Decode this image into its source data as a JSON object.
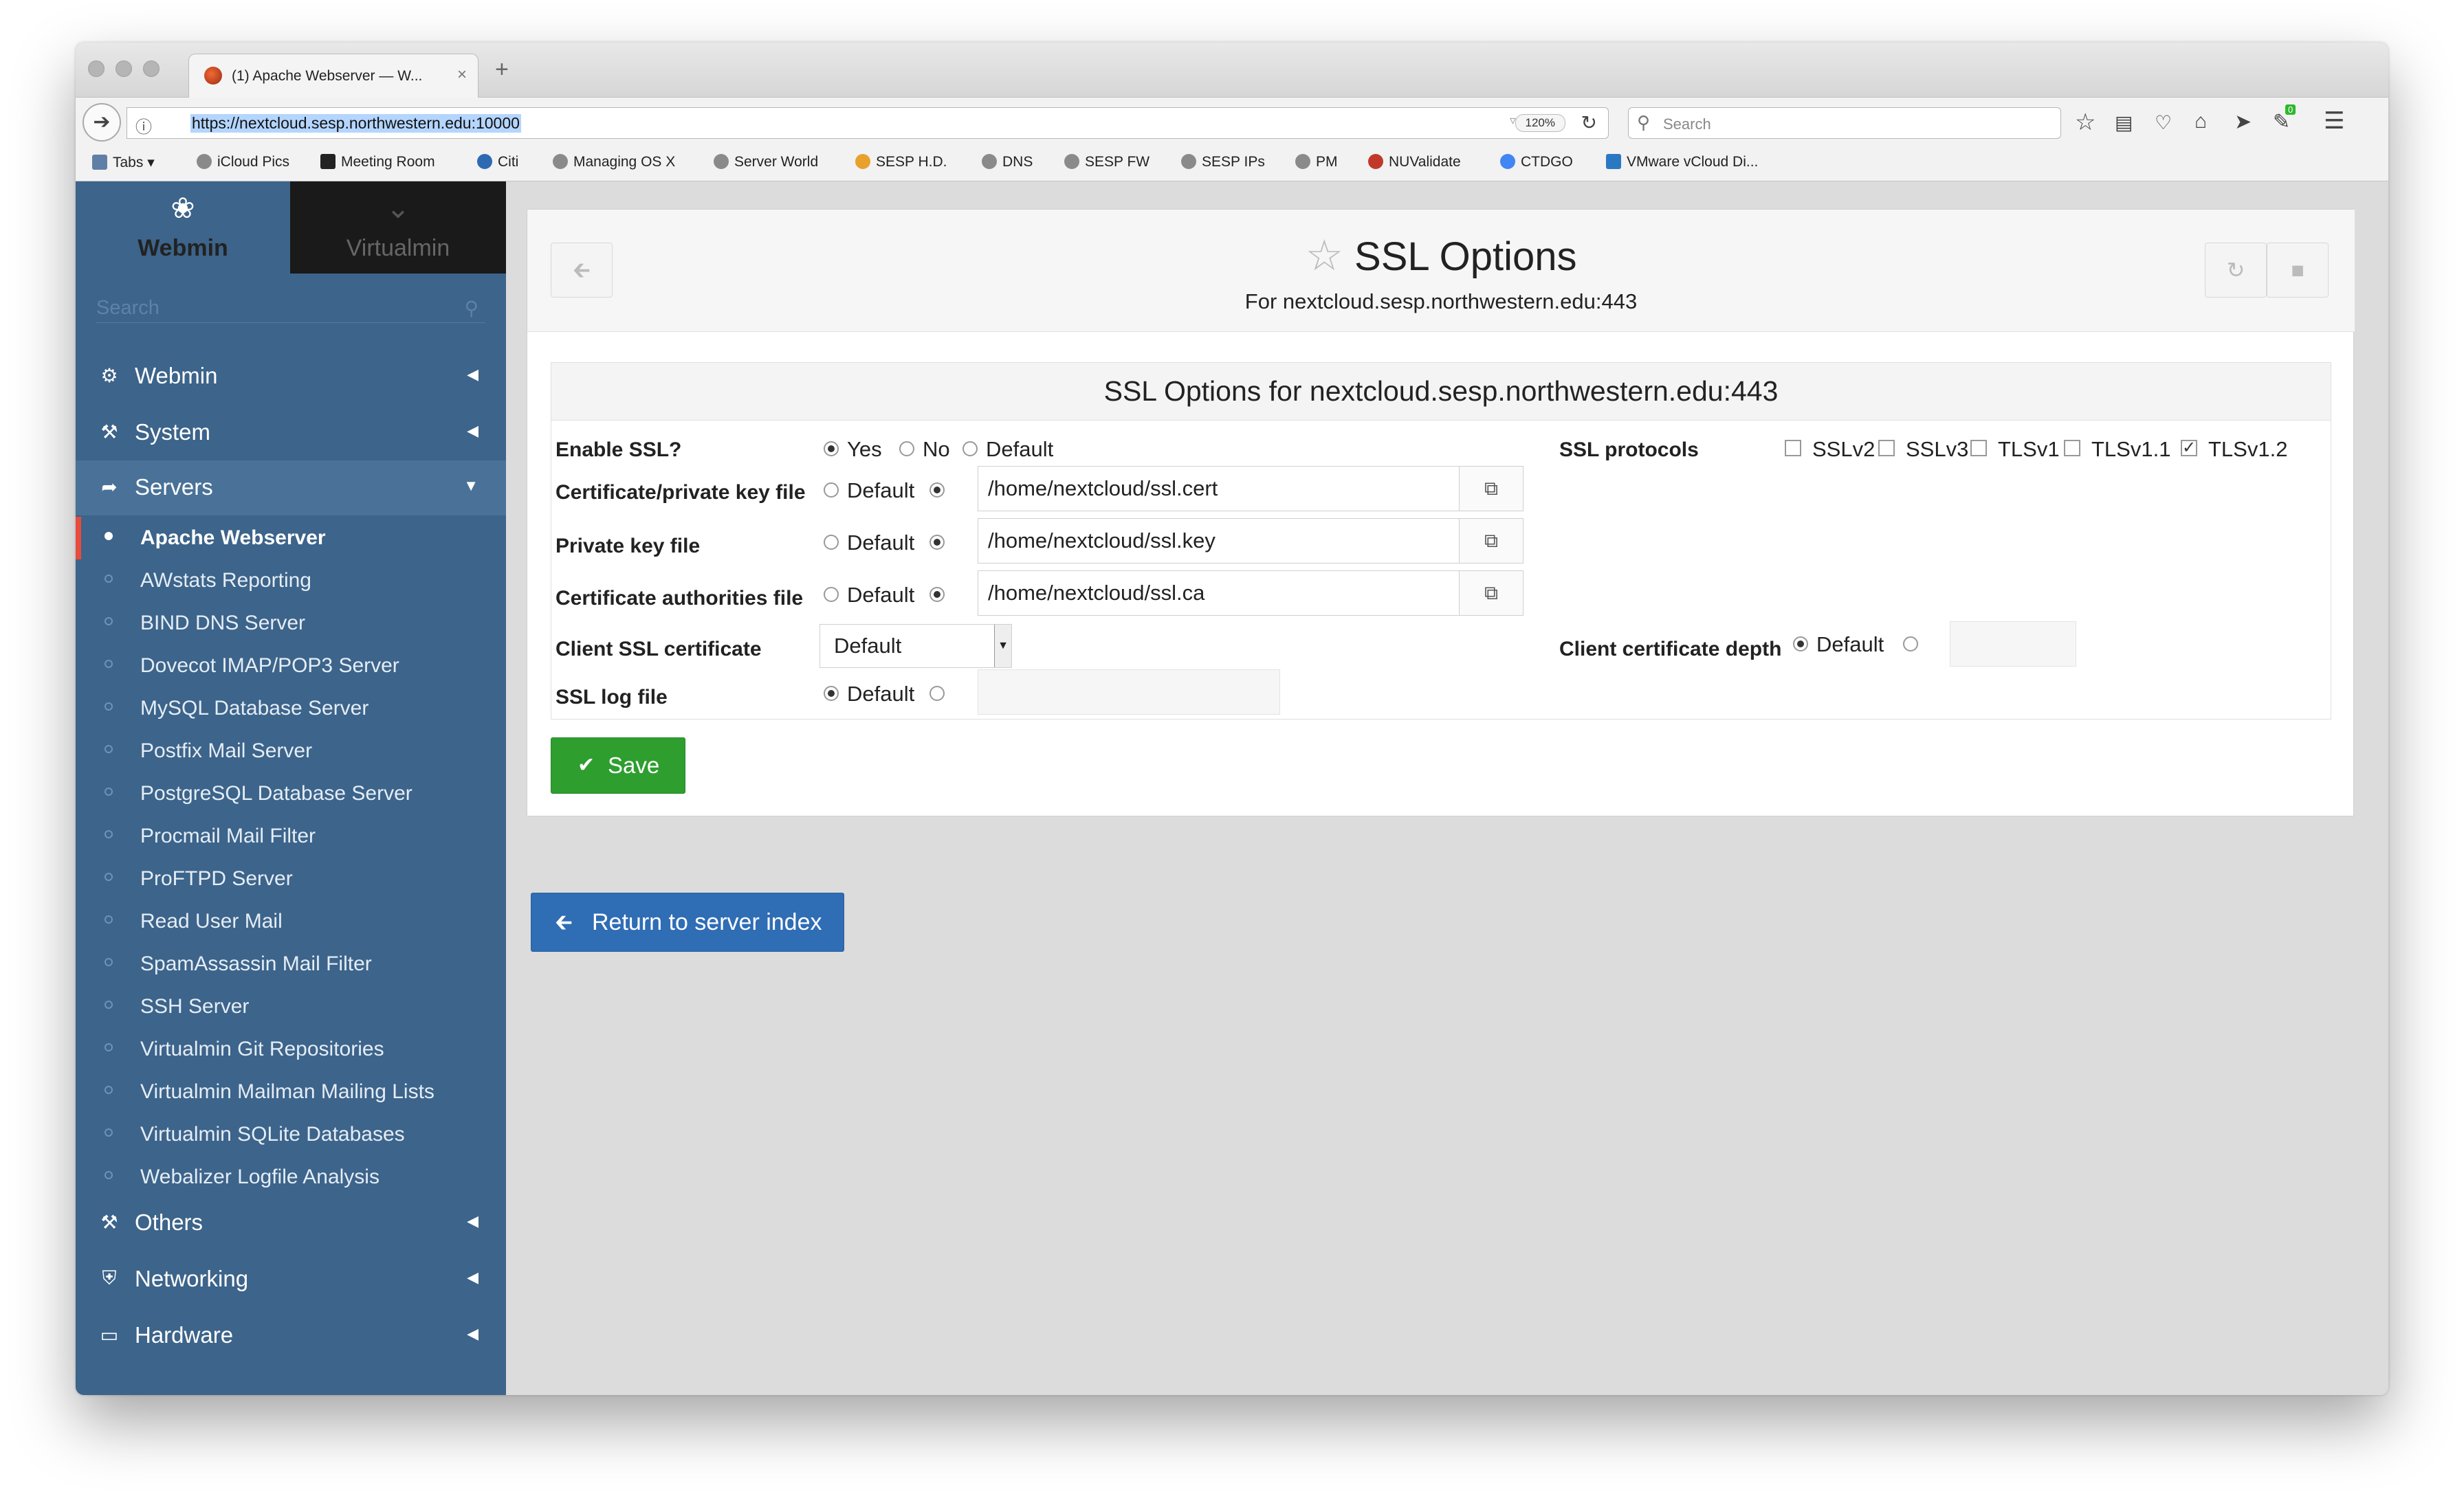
{
  "browser": {
    "tab_title": "(1) Apache Webserver — W...",
    "tab_close": "×",
    "new_tab": "+",
    "url": "https://nextcloud.sesp.northwestern.edu:10000",
    "zoom": "120%",
    "search_placeholder": "Search",
    "bookmarks": [
      "Tabs ▾",
      "iCloud Pics",
      "Meeting Room",
      "Citi",
      "Managing OS X",
      "Server World",
      "SESP H.D.",
      "DNS",
      "SESP FW",
      "SESP IPs",
      "PM",
      "NUValidate",
      "CTDGO",
      "VMware vCloud Di..."
    ],
    "notification_count": "0"
  },
  "sidebar": {
    "tab_webmin": "Webmin",
    "tab_virtualmin": "Virtualmin",
    "search_placeholder": "Search",
    "sections": [
      {
        "label": "Webmin",
        "icon": "gear-icon",
        "glyph": "⚙"
      },
      {
        "label": "System",
        "icon": "wrench-icon",
        "glyph": "🔧"
      },
      {
        "label": "Servers",
        "icon": "rocket-icon",
        "glyph": "➶"
      },
      {
        "label": "Others",
        "icon": "hammer-icon",
        "glyph": "⚒"
      },
      {
        "label": "Networking",
        "icon": "shield-icon",
        "glyph": "⛉"
      },
      {
        "label": "Hardware",
        "icon": "hdd-icon",
        "glyph": "▭"
      }
    ],
    "server_items": [
      "Apache Webserver",
      "AWstats Reporting",
      "BIND DNS Server",
      "Dovecot IMAP/POP3 Server",
      "MySQL Database Server",
      "Postfix Mail Server",
      "PostgreSQL Database Server",
      "Procmail Mail Filter",
      "ProFTPD Server",
      "Read User Mail",
      "SpamAssassin Mail Filter",
      "SSH Server",
      "Virtualmin Git Repositories",
      "Virtualmin Mailman Mailing Lists",
      "Virtualmin SQLite Databases",
      "Webalizer Logfile Analysis"
    ]
  },
  "page": {
    "title": "SSL Options",
    "subtitle": "For nextcloud.sesp.northwestern.edu:443",
    "notifications": "1"
  },
  "form": {
    "heading": "SSL Options for nextcloud.sesp.northwestern.edu:443",
    "enable_ssl": {
      "label": "Enable SSL?",
      "options": [
        "Yes",
        "No",
        "Default"
      ],
      "selected": "Yes"
    },
    "ssl_protocols": {
      "label": "SSL protocols",
      "options": [
        "SSLv2",
        "SSLv3",
        "TLSv1",
        "TLSv1.1",
        "TLSv1.2"
      ],
      "checked": [
        "TLSv1.2"
      ]
    },
    "cert_file": {
      "label": "Certificate/private key file",
      "default_label": "Default",
      "value": "/home/nextcloud/ssl.cert"
    },
    "key_file": {
      "label": "Private key file",
      "default_label": "Default",
      "value": "/home/nextcloud/ssl.key"
    },
    "ca_file": {
      "label": "Certificate authorities file",
      "default_label": "Default",
      "value": "/home/nextcloud/ssl.ca"
    },
    "client_cert": {
      "label": "Client SSL certificate",
      "value": "Default"
    },
    "client_depth": {
      "label": "Client certificate depth",
      "default_label": "Default",
      "value": ""
    },
    "log_file": {
      "label": "SSL log file",
      "default_label": "Default",
      "value": ""
    },
    "save_label": "Save"
  },
  "return_label": "Return to server index"
}
